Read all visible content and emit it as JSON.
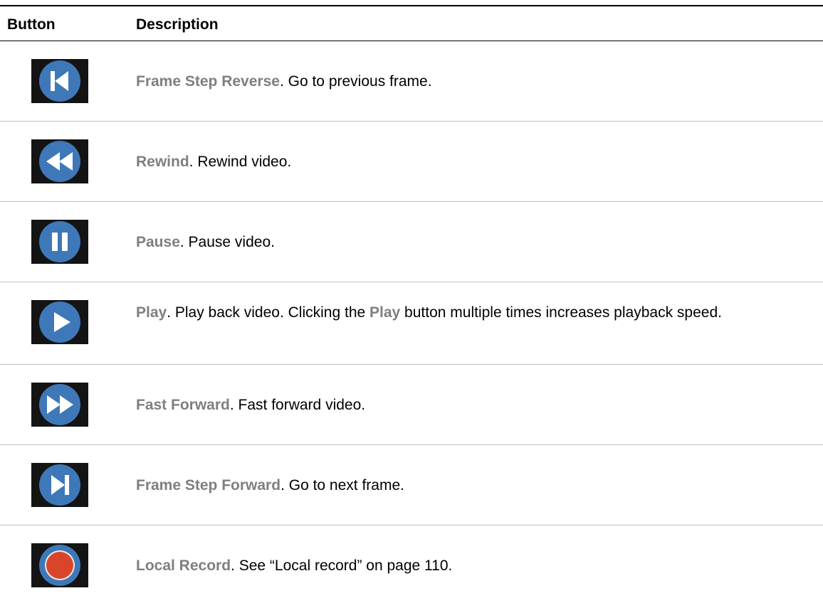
{
  "table": {
    "headers": {
      "button": "Button",
      "description": "Description"
    },
    "rows": [
      {
        "icon": "frame-step-reverse-icon",
        "term": "Frame Step Reverse",
        "text": ". Go to previous frame."
      },
      {
        "icon": "rewind-icon",
        "term": "Rewind",
        "text": ". Rewind video."
      },
      {
        "icon": "pause-icon",
        "term": "Pause",
        "text": ". Pause video."
      },
      {
        "icon": "play-icon",
        "term": "Play",
        "text_a": ". Play back video. Clicking the ",
        "term_inline": "Play",
        "text_b": " button multiple times increases playback speed."
      },
      {
        "icon": "fast-forward-icon",
        "term": "Fast Forward",
        "text": ". Fast forward video."
      },
      {
        "icon": "frame-step-forward-icon",
        "term": "Frame Step Forward",
        "text": ". Go to next frame."
      },
      {
        "icon": "local-record-icon",
        "term": "Local Record",
        "text": ". See “Local record” on page 110."
      }
    ]
  },
  "colors": {
    "icon_blue": "#3f78b8",
    "icon_tile": "#141414",
    "record_red": "#d9452b",
    "term_gray": "#7f7f7f",
    "row_rule": "#bfbfbf"
  }
}
